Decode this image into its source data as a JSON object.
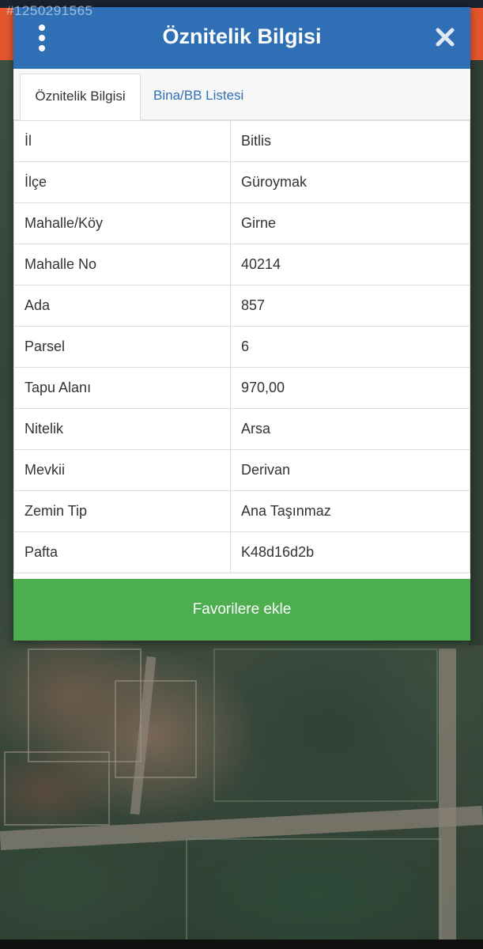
{
  "watermark_id": "#1250291565",
  "dialog": {
    "title": "Öznitelik Bilgisi",
    "menu_icon": "more-vertical-icon",
    "close_icon": "close-icon"
  },
  "tabs": [
    {
      "label": "Öznitelik Bilgisi",
      "active": true
    },
    {
      "label": "Bina/BB Listesi",
      "active": false
    }
  ],
  "attributes": [
    {
      "key": "İl",
      "value": "Bitlis"
    },
    {
      "key": "İlçe",
      "value": "Güroymak"
    },
    {
      "key": "Mahalle/Köy",
      "value": "Girne"
    },
    {
      "key": "Mahalle No",
      "value": "40214"
    },
    {
      "key": "Ada",
      "value": "857"
    },
    {
      "key": "Parsel",
      "value": "6"
    },
    {
      "key": "Tapu Alanı",
      "value": "970,00"
    },
    {
      "key": "Nitelik",
      "value": "Arsa"
    },
    {
      "key": "Mevkii",
      "value": "Derivan"
    },
    {
      "key": "Zemin Tip",
      "value": "Ana Taşınmaz"
    },
    {
      "key": "Pafta",
      "value": "K48d16d2b"
    }
  ],
  "favorite_button": {
    "label": "Favorilere ekle"
  },
  "colors": {
    "header": "#2f6fb6",
    "button": "#4cae4f",
    "tab_link": "#2f6fb6",
    "top_bar": "#e4572e"
  }
}
